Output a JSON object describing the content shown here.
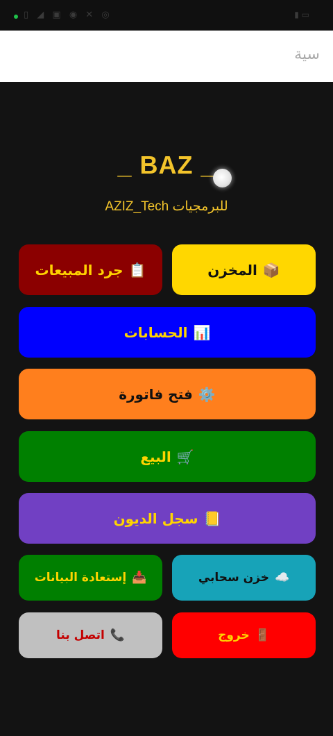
{
  "header": {
    "title": "سية"
  },
  "brand": {
    "title": "_ BAZ _",
    "subtitle": "للبرمجيات AZIZ_Tech"
  },
  "buttons": {
    "store": {
      "label": "المخزن",
      "icon": "📦"
    },
    "sales_inventory": {
      "label": "جرد المبيعات",
      "icon": "📋"
    },
    "accounts": {
      "label": "الحسابات",
      "icon": "📊"
    },
    "open_invoice": {
      "label": "فتح فاتورة",
      "icon": "⚙️"
    },
    "sell": {
      "label": "البيع",
      "icon": "🛒"
    },
    "debts_log": {
      "label": "سجل الديون",
      "icon": "📒"
    },
    "cloud_storage": {
      "label": "خزن سحابي",
      "icon": "☁️"
    },
    "restore_data": {
      "label": "إستعادة البيانات",
      "icon": "📥"
    },
    "exit": {
      "label": "خروج",
      "icon": "🚪"
    },
    "contact_us": {
      "label": "اتصل بنا",
      "icon": "📞"
    }
  },
  "colors": {
    "background": "#131313",
    "brand_yellow": "#f3c42b",
    "store": "#ffd700",
    "sales_inventory": "#8b0000",
    "accounts": "#0000ff",
    "open_invoice": "#ff7f1d",
    "sell": "#008000",
    "debts_log": "#7140c3",
    "cloud_storage": "#17a3b8",
    "restore_data": "#007f00",
    "exit": "#ff0000",
    "contact_us": "#c0c0c0"
  }
}
